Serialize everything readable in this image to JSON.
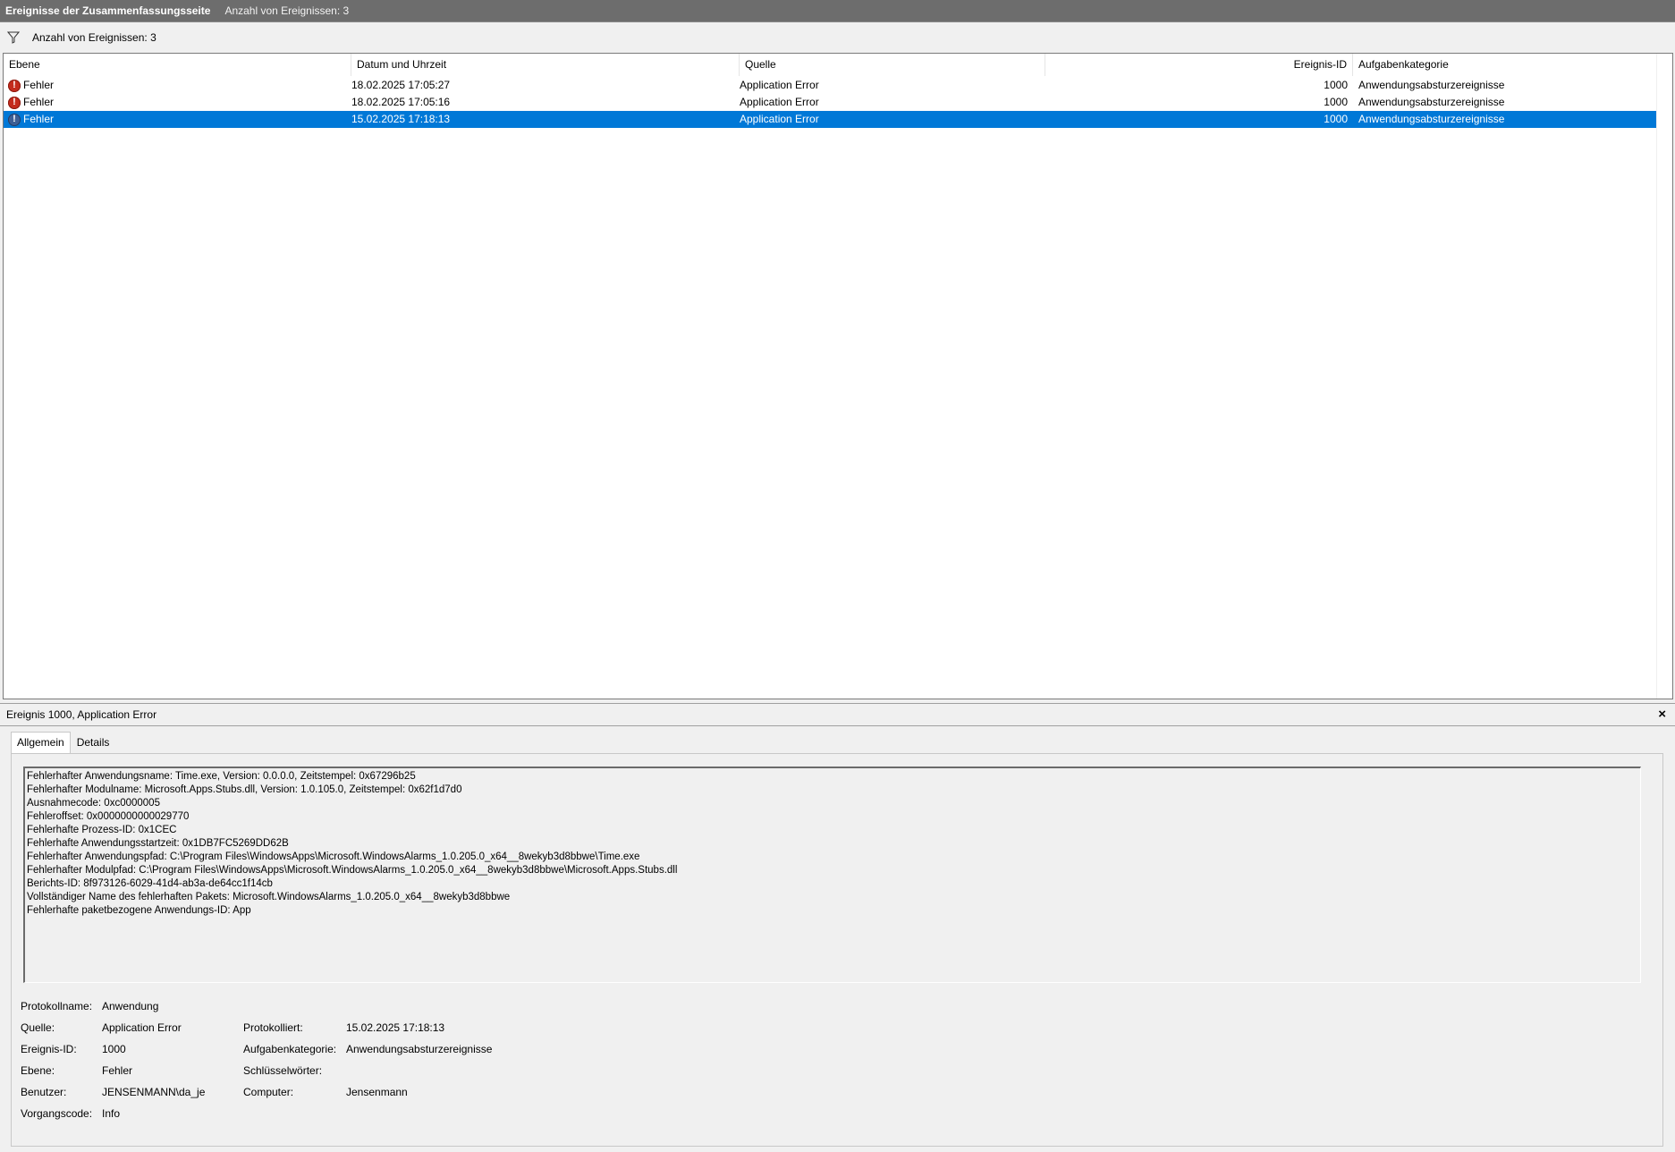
{
  "titlebar": {
    "title": "Ereignisse der Zusammenfassungsseite",
    "count": "Anzahl von Ereignissen: 3"
  },
  "filterbar": {
    "icon": "filter-icon",
    "text": "Anzahl von Ereignissen: 3"
  },
  "table": {
    "columns": [
      "Ebene",
      "Datum und Uhrzeit",
      "Quelle",
      "Ereignis-ID",
      "Aufgabenkategorie"
    ],
    "rows": [
      {
        "level": "Fehler",
        "datetime": "18.02.2025 17:05:27",
        "source": "Application Error",
        "id": "1000",
        "category": "Anwendungsabsturzereignisse"
      },
      {
        "level": "Fehler",
        "datetime": "18.02.2025 17:05:16",
        "source": "Application Error",
        "id": "1000",
        "category": "Anwendungsabsturzereignisse"
      },
      {
        "level": "Fehler",
        "datetime": "15.02.2025 17:18:13",
        "source": "Application Error",
        "id": "1000",
        "category": "Anwendungsabsturzereignisse"
      }
    ],
    "selected_row": 2
  },
  "detail": {
    "title": "Ereignis 1000, Application Error",
    "close": "×",
    "tabs": [
      "Allgemein",
      "Details"
    ],
    "description": [
      "Fehlerhafter Anwendungsname: Time.exe, Version: 0.0.0.0, Zeitstempel: 0x67296b25",
      "Fehlerhafter Modulname: Microsoft.Apps.Stubs.dll, Version: 1.0.105.0, Zeitstempel: 0x62f1d7d0",
      "Ausnahmecode: 0xc0000005",
      "Fehleroffset: 0x0000000000029770",
      "Fehlerhafte Prozess-ID: 0x1CEC",
      "Fehlerhafte Anwendungsstartzeit: 0x1DB7FC5269DD62B",
      "Fehlerhafter Anwendungspfad: C:\\Program Files\\WindowsApps\\Microsoft.WindowsAlarms_1.0.205.0_x64__8wekyb3d8bbwe\\Time.exe",
      "Fehlerhafter Modulpfad: C:\\Program Files\\WindowsApps\\Microsoft.WindowsAlarms_1.0.205.0_x64__8wekyb3d8bbwe\\Microsoft.Apps.Stubs.dll",
      "Berichts-ID: 8f973126-6029-41d4-ab3a-de64cc1f14cb",
      "Vollständiger Name des fehlerhaften Pakets: Microsoft.WindowsAlarms_1.0.205.0_x64__8wekyb3d8bbwe",
      "Fehlerhafte paketbezogene Anwendungs-ID: App"
    ],
    "props": {
      "protokollname_label": "Protokollname:",
      "protokollname": "Anwendung",
      "quelle_label": "Quelle:",
      "quelle": "Application Error",
      "protokolliert_label": "Protokolliert:",
      "protokolliert": "15.02.2025 17:18:13",
      "ereignisid_label": "Ereignis-ID:",
      "ereignisid": "1000",
      "aufgabenkategorie_label": "Aufgabenkategorie:",
      "aufgabenkategorie": "Anwendungsabsturzereignisse",
      "ebene_label": "Ebene:",
      "ebene": "Fehler",
      "schluesselwoerter_label": "Schlüsselwörter:",
      "schluesselwoerter": "",
      "benutzer_label": "Benutzer:",
      "benutzer": "JENSENMANN\\da_je",
      "computer_label": "Computer:",
      "computer": "Jensenmann",
      "vorgangscode_label": "Vorgangscode:",
      "vorgangscode": "Info"
    }
  },
  "colors": {
    "selection": "#0078d7",
    "titlebar": "#6d6d6d",
    "error_icon": "#c42b1c"
  }
}
